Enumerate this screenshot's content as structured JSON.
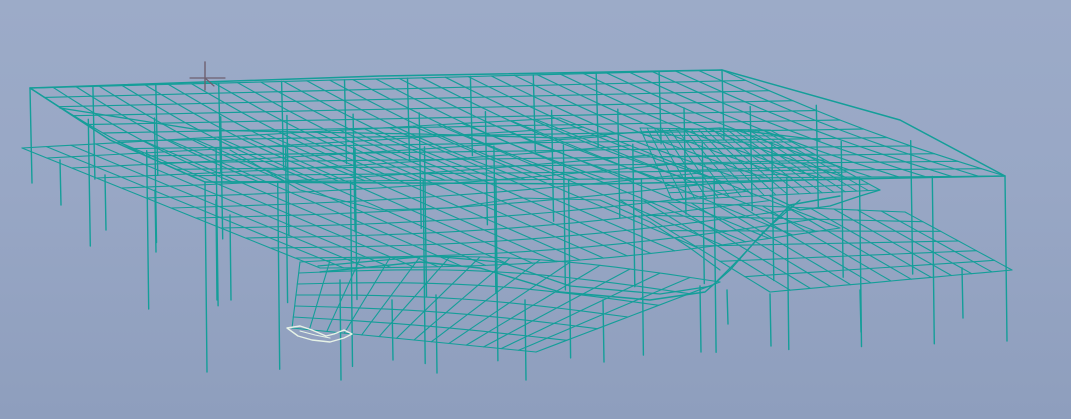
{
  "viewport": {
    "background_top": "#9cabc8",
    "background_bottom": "#8e9ebd"
  },
  "model": {
    "wire_color": "#149e99",
    "highlight_color": "#e6f2e6",
    "axis_color": "#6e6070"
  }
}
